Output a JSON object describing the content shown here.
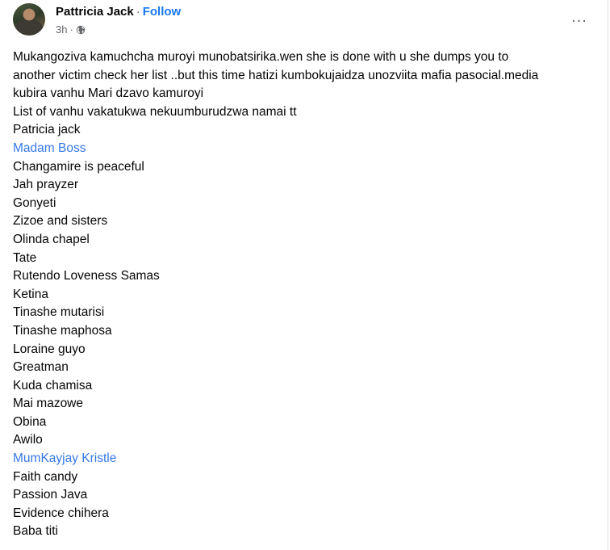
{
  "post": {
    "author": "Pattricia Jack",
    "separator": "·",
    "follow_label": "Follow",
    "time": "3h",
    "meta_separator": "·",
    "privacy_icon": "globe-icon",
    "more_icon": "more-options-icon",
    "intro_lines": [
      "Mukangoziva kamuchcha muroyi munobatsirika.wen she is done with u she dumps you to",
      "another victim check  her list ..but this time hatizi kumbokujaidza unozviita mafia pasocial.media",
      "kubira vanhu Mari dzavo kamuroyi",
      "List of vanhu vakatukwa nekuumburudzwa namai tt"
    ],
    "list": [
      {
        "text": "Patricia jack",
        "mention": false
      },
      {
        "text": "Madam Boss",
        "mention": true
      },
      {
        "text": "Changamire is peaceful",
        "mention": false
      },
      {
        "text": "Jah prayzer",
        "mention": false
      },
      {
        "text": "Gonyeti",
        "mention": false
      },
      {
        "text": "Zizoe and sisters",
        "mention": false
      },
      {
        "text": "Olinda chapel",
        "mention": false
      },
      {
        "text": "Tate",
        "mention": false
      },
      {
        "text": "Rutendo Loveness Samas",
        "mention": false
      },
      {
        "text": "Ketina",
        "mention": false
      },
      {
        "text": "Tinashe mutarisi",
        "mention": false
      },
      {
        "text": "Tinashe maphosa",
        "mention": false
      },
      {
        "text": "Loraine guyo",
        "mention": false
      },
      {
        "text": "Greatman",
        "mention": false
      },
      {
        "text": "Kuda chamisa",
        "mention": false
      },
      {
        "text": "Mai mazowe",
        "mention": false
      },
      {
        "text": "Obina",
        "mention": false
      },
      {
        "text": "Awilo",
        "mention": false
      },
      {
        "text": "MumKayjay Kristle",
        "mention": true
      },
      {
        "text": "Faith candy",
        "mention": false
      },
      {
        "text": "Passion Java",
        "mention": false
      },
      {
        "text": "Evidence chihera",
        "mention": false
      },
      {
        "text": "Baba titi",
        "mention": false
      }
    ]
  },
  "colors": {
    "mention": "#3578e5",
    "follow": "#1877f2",
    "meta": "#65676b",
    "text": "#050505"
  }
}
